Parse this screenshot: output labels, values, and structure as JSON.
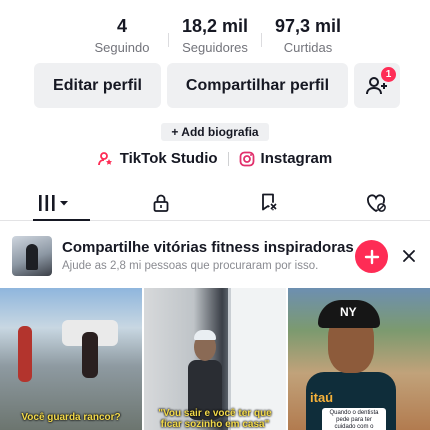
{
  "stats": [
    {
      "value": "4",
      "label": "Seguindo"
    },
    {
      "value": "18,2 mil",
      "label": "Seguidores"
    },
    {
      "value": "97,3 mil",
      "label": "Curtidas"
    }
  ],
  "actions": {
    "edit_label": "Editar perfil",
    "share_label": "Compartilhar perfil",
    "friend_badge": "1"
  },
  "bio_button": "+ Add biografia",
  "links": {
    "studio": "TikTok Studio",
    "instagram": "Instagram"
  },
  "colors": {
    "accent": "#fe2c55",
    "button_bg": "#eff0f2",
    "text": "#161823",
    "muted": "#73747b"
  },
  "tabs": [
    {
      "icon": "grid-icon",
      "active": true
    },
    {
      "icon": "lock-icon",
      "active": false
    },
    {
      "icon": "bookmark-icon",
      "active": false
    },
    {
      "icon": "liked-heart-icon",
      "active": false
    }
  ],
  "suggestion": {
    "title": "Compartilhe vitórias fitness inspiradoras",
    "subtitle": "Ajude as 2,8 mi pessoas que procuraram por isso."
  },
  "videos": [
    {
      "caption": "Você guarda rancor?"
    },
    {
      "caption": "\"Vou sair e você ter que ficar sozinho em casa\""
    },
    {
      "caption": "Quando o dentista pede para ter cuidado com o",
      "brand": "itaú",
      "cap_text": "NY"
    }
  ]
}
